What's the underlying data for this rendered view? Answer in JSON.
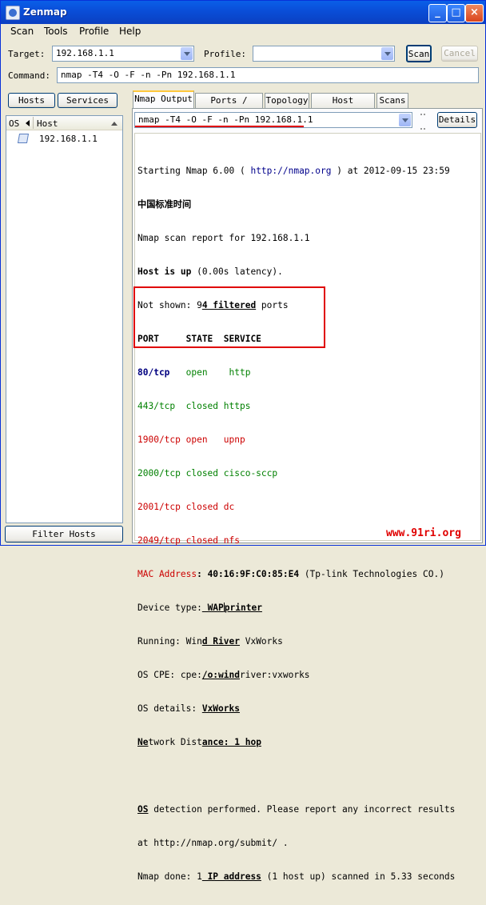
{
  "window": {
    "title": "Zenmap"
  },
  "menu": [
    "Scan",
    "Tools",
    "Profile",
    "Help"
  ],
  "toolbar": {
    "target_label": "Target:",
    "target_value": "192.168.1.1",
    "profile_label": "Profile:",
    "profile_value": "",
    "scan_button": "Scan",
    "cancel_button": "Cancel",
    "command_label": "Command:",
    "command_value": "nmap -T4 -O -F -n -Pn 192.168.1.1"
  },
  "left": {
    "hosts_button": "Hosts",
    "services_button": "Services",
    "col_os": "OS",
    "col_host": "Host",
    "hosts": [
      "192.168.1.1"
    ],
    "filter_button": "Filter Hosts"
  },
  "tabs": [
    "Nmap Output",
    "Ports / Hosts",
    "Topology",
    "Host Details",
    "Scans"
  ],
  "output": {
    "command_combo": "nmap -T4 -O -F -n -Pn 192.168.1.1",
    "details_button": "Details",
    "l1_a": "Starting Nmap 6.00 ( ",
    "l1_url": "http://nmap.org",
    "l1_b": " ) at 2012-09-15 23:59",
    "l2": "中国标准时间",
    "l3": "Nmap scan report for 192.168.1.1",
    "l4_a": "Host is up",
    "l4_b": " (0.00s latency).",
    "l5_a": "Not shown: 9",
    "l5_b": "4 filtered",
    "l5_c": " ports",
    "hdr": "PORT     STATE  SERVICE",
    "p1": [
      "80/tcp  ",
      " open   ",
      " http"
    ],
    "p2": "443/tcp  closed https",
    "p3": "1900/tcp open   upnp",
    "p4": "2000/tcp closed cisco-sccp",
    "p5": "2001/tcp closed dc",
    "p6": "2049/tcp closed nfs",
    "mac_a": "MAC Address",
    "mac_b": ": 40:16:9F:C0:85:E4",
    "mac_c": " (Tp-link Technologies CO.)",
    "dt_a": "Device type:",
    "dt_b": " WAP",
    "dt_c": "printer",
    "run_a": "Running: Win",
    "run_b": "d River",
    "run_c": " VxWorks",
    "cpe_a": "OS CPE: cpe:",
    "cpe_b": "/o:wind",
    "cpe_c": "river:vxworks",
    "osd_a": "OS details: ",
    "osd_b": "VxWorks",
    "nd_a": "Ne",
    "nd_b": "twork Dist",
    "nd_c": "ance: 1 hop",
    "det_a": "OS",
    "det_b": " detection performed. Please report any incorrect results",
    "det_c": "at http://nmap.org/submit/ .",
    "done_a": "Nmap done: 1",
    "done_b": " IP address",
    "done_c": " (1 host up) scanned in 5.33 seconds"
  },
  "watermark": "www.91ri.org"
}
